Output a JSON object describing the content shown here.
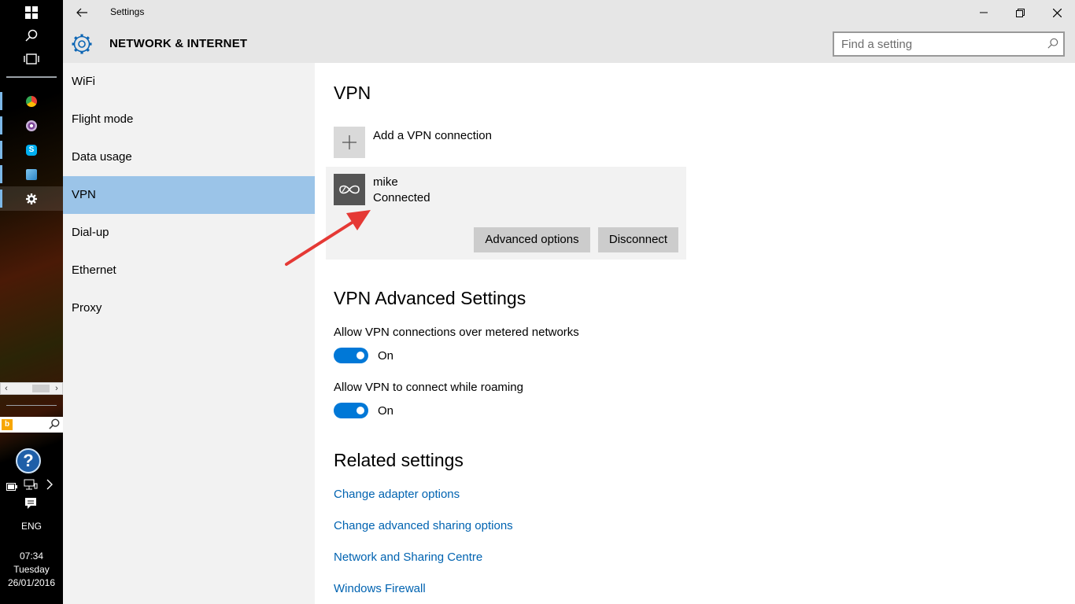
{
  "taskbar": {
    "start_icon": "windows-logo-icon",
    "search_icon": "search-icon",
    "task_view_icon": "task-view-icon",
    "apps": [
      {
        "name": "chrome-app-icon",
        "color": "#e94235"
      },
      {
        "name": "tor-browser-app-icon",
        "color": "#7d4698"
      },
      {
        "name": "skype-app-icon",
        "color": "#00aff0"
      },
      {
        "name": "control-panel-app-icon",
        "color": "#3a9bd5"
      },
      {
        "name": "settings-app-icon",
        "color": "#ffffff"
      }
    ],
    "language": "ENG",
    "time": "07:34",
    "day": "Tuesday",
    "date": "26/01/2016"
  },
  "window": {
    "title": "Settings",
    "header_title": "NETWORK & INTERNET",
    "search_placeholder": "Find a setting"
  },
  "nav": {
    "items": [
      {
        "label": "WiFi",
        "selected": false
      },
      {
        "label": "Flight mode",
        "selected": false
      },
      {
        "label": "Data usage",
        "selected": false
      },
      {
        "label": "VPN",
        "selected": true
      },
      {
        "label": "Dial-up",
        "selected": false
      },
      {
        "label": "Ethernet",
        "selected": false
      },
      {
        "label": "Proxy",
        "selected": false
      }
    ]
  },
  "main": {
    "vpn_heading": "VPN",
    "add_vpn_label": "Add a VPN connection",
    "connection": {
      "name": "mike",
      "status": "Connected",
      "advanced_button": "Advanced options",
      "disconnect_button": "Disconnect"
    },
    "advanced_heading": "VPN Advanced Settings",
    "metered": {
      "label": "Allow VPN connections over metered networks",
      "state": "On"
    },
    "roaming": {
      "label": "Allow VPN to connect while roaming",
      "state": "On"
    },
    "related_heading": "Related settings",
    "links": [
      "Change adapter options",
      "Change advanced sharing options",
      "Network and Sharing Centre",
      "Windows Firewall"
    ]
  },
  "colors": {
    "accent": "#0078d7",
    "link": "#0063b1",
    "nav_selected": "#9bc4e8",
    "annotation_arrow": "#e53935"
  }
}
